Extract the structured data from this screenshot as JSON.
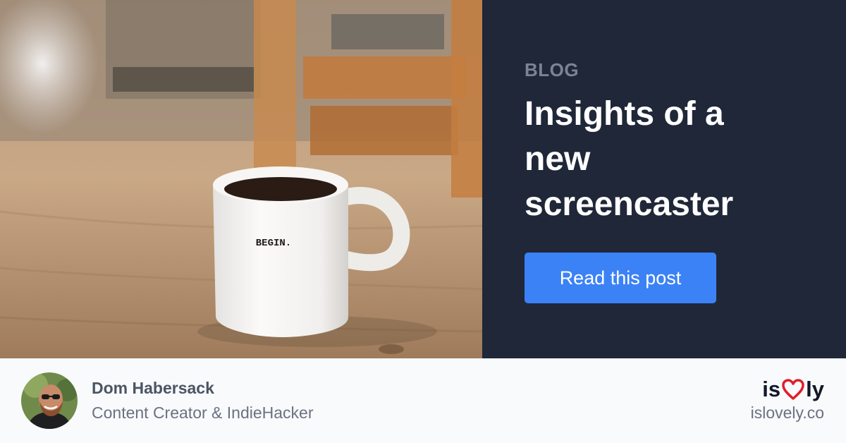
{
  "photo": {
    "mug_text": "BEGIN."
  },
  "panel": {
    "eyebrow": "BLOG",
    "title_lines": [
      "Insights of a",
      "new",
      "screencaster"
    ],
    "cta_label": "Read this post"
  },
  "author": {
    "name": "Dom Habersack",
    "role": "Content Creator & IndieHacker"
  },
  "brand": {
    "logo_prefix": "is",
    "logo_suffix": "ly",
    "domain": "islovely.co"
  },
  "colors": {
    "panel_bg": "#1f2738",
    "accent": "#3b82f6",
    "heart": "#e11d2a"
  }
}
